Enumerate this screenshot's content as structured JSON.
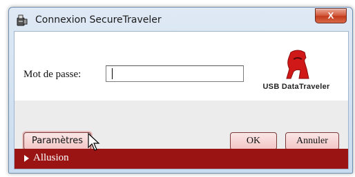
{
  "window": {
    "title": "Connexion SecureTraveler",
    "close_label": "X"
  },
  "form": {
    "password_label": "Mot de passe:",
    "password_value": ""
  },
  "logo": {
    "text": "USB DataTraveler",
    "brand_color": "#d01818"
  },
  "buttons": {
    "settings_label": "Paramètres",
    "ok_label": "OK",
    "cancel_label": "Annuler"
  },
  "hint": {
    "label": "Allusion"
  },
  "colors": {
    "accent_red": "#9a1414",
    "button_pink": "#f2c4c4"
  }
}
